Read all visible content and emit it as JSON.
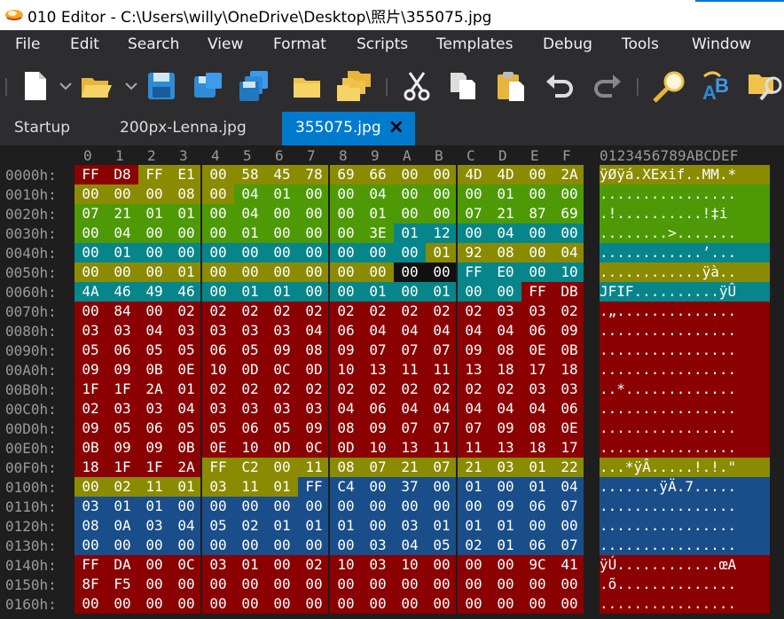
{
  "window": {
    "title": "010 Editor - C:\\Users\\willy\\OneDrive\\Desktop\\照片\\355075.jpg"
  },
  "menu": [
    "File",
    "Edit",
    "Search",
    "View",
    "Format",
    "Scripts",
    "Templates",
    "Debug",
    "Tools",
    "Window"
  ],
  "toolbar": [
    "new-file-icon",
    "open-file-icon",
    "save-icon",
    "save-as-icon",
    "save-all-icon",
    "open-folder-icon",
    "open-multiple-icon",
    "cut-icon",
    "copy-icon",
    "paste-icon",
    "undo-icon",
    "redo-icon",
    "find-icon",
    "replace-icon",
    "find-in-files-icon"
  ],
  "tabs": [
    {
      "label": "Startup",
      "active": false
    },
    {
      "label": "200px-Lenna.jpg",
      "active": false
    },
    {
      "label": "355075.jpg",
      "active": true,
      "close": "×"
    }
  ],
  "hex_header": {
    "columns": [
      "0",
      "1",
      "2",
      "3",
      "4",
      "5",
      "6",
      "7",
      "8",
      "9",
      "A",
      "B",
      "C",
      "D",
      "E",
      "F"
    ],
    "ascii": "0123456789ABCDEF"
  },
  "colors": {
    "red": "#8b0000",
    "olive": "#8b8b00",
    "green": "#4e9a06",
    "teal": "#06868b",
    "blue": "#1a4e8a",
    "dark": "#111111"
  },
  "rows": [
    {
      "addr": "0000h:",
      "bytes": [
        "FF",
        "D8",
        "FF",
        "E1",
        "00",
        "58",
        "45",
        "78",
        "69",
        "66",
        "00",
        "00",
        "4D",
        "4D",
        "00",
        "2A"
      ],
      "colors": "rrooooooooooooooo",
      "ascii": "ÿØÿá.XExif..MM.*"
    },
    {
      "addr": "0010h:",
      "bytes": [
        "00",
        "00",
        "00",
        "08",
        "00",
        "04",
        "01",
        "00",
        "00",
        "04",
        "00",
        "00",
        "00",
        "01",
        "00",
        "00"
      ],
      "colors": "oooooggggggggggg",
      "ascii": "................"
    },
    {
      "addr": "0020h:",
      "bytes": [
        "07",
        "21",
        "01",
        "01",
        "00",
        "04",
        "00",
        "00",
        "00",
        "01",
        "00",
        "00",
        "07",
        "21",
        "87",
        "69"
      ],
      "colors": "gggggggggggggggg",
      "ascii": ".!..........!‡i"
    },
    {
      "addr": "0030h:",
      "bytes": [
        "00",
        "04",
        "00",
        "00",
        "00",
        "01",
        "00",
        "00",
        "00",
        "3E",
        "01",
        "12",
        "00",
        "04",
        "00",
        "00"
      ],
      "colors": "ggggggggggttttttt",
      "ascii": "........>......."
    },
    {
      "addr": "0040h:",
      "bytes": [
        "00",
        "01",
        "00",
        "00",
        "00",
        "00",
        "00",
        "00",
        "00",
        "00",
        "00",
        "01",
        "92",
        "08",
        "00",
        "04"
      ],
      "colors": "tttttttttttoooooo",
      "ascii": "............’..."
    },
    {
      "addr": "0050h:",
      "bytes": [
        "00",
        "00",
        "00",
        "01",
        "00",
        "00",
        "00",
        "00",
        "00",
        "00",
        "00",
        "00",
        "FF",
        "E0",
        "00",
        "10"
      ],
      "colors": "ooooooooooddtttt",
      "ascii": "............ÿà.."
    },
    {
      "addr": "0060h:",
      "bytes": [
        "4A",
        "46",
        "49",
        "46",
        "00",
        "01",
        "01",
        "00",
        "00",
        "01",
        "00",
        "01",
        "00",
        "00",
        "FF",
        "DB"
      ],
      "colors": "ttttttttttttttrr",
      "ascii": "JFIF..........ÿÛ"
    },
    {
      "addr": "0070h:",
      "bytes": [
        "00",
        "84",
        "00",
        "02",
        "02",
        "02",
        "02",
        "02",
        "02",
        "02",
        "02",
        "02",
        "02",
        "03",
        "03",
        "02"
      ],
      "colors": "rrrrrrrrrrrrrrrr",
      "ascii": ".„.............."
    },
    {
      "addr": "0080h:",
      "bytes": [
        "03",
        "03",
        "04",
        "03",
        "03",
        "03",
        "03",
        "04",
        "06",
        "04",
        "04",
        "04",
        "04",
        "04",
        "06",
        "09"
      ],
      "colors": "rrrrrrrrrrrrrrrr",
      "ascii": "................"
    },
    {
      "addr": "0090h:",
      "bytes": [
        "05",
        "06",
        "05",
        "05",
        "06",
        "05",
        "09",
        "08",
        "09",
        "07",
        "07",
        "07",
        "09",
        "08",
        "0E",
        "0B"
      ],
      "colors": "rrrrrrrrrrrrrrrr",
      "ascii": "................"
    },
    {
      "addr": "00A0h:",
      "bytes": [
        "09",
        "09",
        "0B",
        "0E",
        "10",
        "0D",
        "0C",
        "0D",
        "10",
        "13",
        "11",
        "11",
        "13",
        "18",
        "17",
        "18"
      ],
      "colors": "rrrrrrrrrrrrrrrr",
      "ascii": "................"
    },
    {
      "addr": "00B0h:",
      "bytes": [
        "1F",
        "1F",
        "2A",
        "01",
        "02",
        "02",
        "02",
        "02",
        "02",
        "02",
        "02",
        "02",
        "02",
        "02",
        "03",
        "03"
      ],
      "colors": "rrrrrrrrrrrrrrrr",
      "ascii": "..*............."
    },
    {
      "addr": "00C0h:",
      "bytes": [
        "02",
        "03",
        "03",
        "04",
        "03",
        "03",
        "03",
        "03",
        "04",
        "06",
        "04",
        "04",
        "04",
        "04",
        "04",
        "06"
      ],
      "colors": "rrrrrrrrrrrrrrrr",
      "ascii": "................"
    },
    {
      "addr": "00D0h:",
      "bytes": [
        "09",
        "05",
        "06",
        "05",
        "05",
        "06",
        "05",
        "09",
        "08",
        "09",
        "07",
        "07",
        "07",
        "09",
        "08",
        "0E"
      ],
      "colors": "rrrrrrrrrrrrrrrr",
      "ascii": "................"
    },
    {
      "addr": "00E0h:",
      "bytes": [
        "0B",
        "09",
        "09",
        "0B",
        "0E",
        "10",
        "0D",
        "0C",
        "0D",
        "10",
        "13",
        "11",
        "11",
        "13",
        "18",
        "17"
      ],
      "colors": "rrrrrrrrrrrrrrrr",
      "ascii": "................"
    },
    {
      "addr": "00F0h:",
      "bytes": [
        "18",
        "1F",
        "1F",
        "2A",
        "FF",
        "C2",
        "00",
        "11",
        "08",
        "07",
        "21",
        "07",
        "21",
        "03",
        "01",
        "22"
      ],
      "colors": "rrrroooooooooooo",
      "ascii": "...*ÿÂ.....!.!.\""
    },
    {
      "addr": "0100h:",
      "bytes": [
        "00",
        "02",
        "11",
        "01",
        "03",
        "11",
        "01",
        "FF",
        "C4",
        "00",
        "37",
        "00",
        "01",
        "00",
        "01",
        "04"
      ],
      "colors": "ooooooobbbbbbbbb",
      "ascii": ".......ÿÄ.7....."
    },
    {
      "addr": "0110h:",
      "bytes": [
        "03",
        "01",
        "01",
        "00",
        "00",
        "00",
        "00",
        "00",
        "00",
        "00",
        "00",
        "00",
        "00",
        "09",
        "06",
        "07"
      ],
      "colors": "bbbbbbbbbbbbbbbb",
      "ascii": "................"
    },
    {
      "addr": "0120h:",
      "bytes": [
        "08",
        "0A",
        "03",
        "04",
        "05",
        "02",
        "01",
        "01",
        "01",
        "00",
        "03",
        "01",
        "01",
        "01",
        "00",
        "00"
      ],
      "colors": "bbbbbbbbbbbbbbbb",
      "ascii": "................"
    },
    {
      "addr": "0130h:",
      "bytes": [
        "00",
        "00",
        "00",
        "00",
        "00",
        "00",
        "00",
        "00",
        "00",
        "03",
        "04",
        "05",
        "02",
        "01",
        "06",
        "07"
      ],
      "colors": "bbbbbbbbbbbbbbbb",
      "ascii": "................"
    },
    {
      "addr": "0140h:",
      "bytes": [
        "FF",
        "DA",
        "00",
        "0C",
        "03",
        "01",
        "00",
        "02",
        "10",
        "03",
        "10",
        "00",
        "00",
        "00",
        "9C",
        "41"
      ],
      "colors": "rrrrrrrrrrrrrrrr",
      "ascii": "ÿÚ............œA"
    },
    {
      "addr": "0150h:",
      "bytes": [
        "8F",
        "F5",
        "00",
        "00",
        "00",
        "00",
        "00",
        "00",
        "00",
        "00",
        "00",
        "00",
        "00",
        "00",
        "00",
        "00"
      ],
      "colors": "rrrrrrrrrrrrrrrr",
      "ascii": ".õ.............."
    },
    {
      "addr": "0160h:",
      "bytes": [
        "00",
        "00",
        "00",
        "00",
        "00",
        "00",
        "00",
        "00",
        "00",
        "00",
        "00",
        "00",
        "00",
        "00",
        "00",
        "00"
      ],
      "colors": "rrrrrrrrrrrrrrrr",
      "ascii": "................"
    }
  ]
}
